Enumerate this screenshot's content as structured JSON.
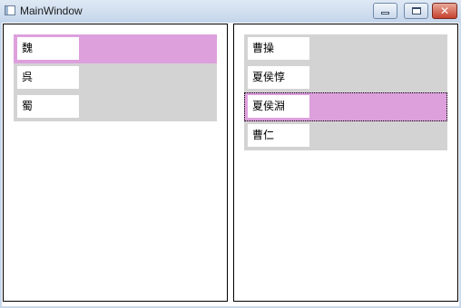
{
  "window": {
    "title": "MainWindow"
  },
  "left_list": {
    "items": [
      {
        "label": "魏"
      },
      {
        "label": "呉"
      },
      {
        "label": "蜀"
      }
    ]
  },
  "right_list": {
    "items": [
      {
        "label": "曹操"
      },
      {
        "label": "夏侯惇"
      },
      {
        "label": "夏侯淵"
      },
      {
        "label": "曹仁"
      }
    ]
  },
  "colors": {
    "selected": "#dda0dd",
    "list_background": "#d3d3d3"
  }
}
